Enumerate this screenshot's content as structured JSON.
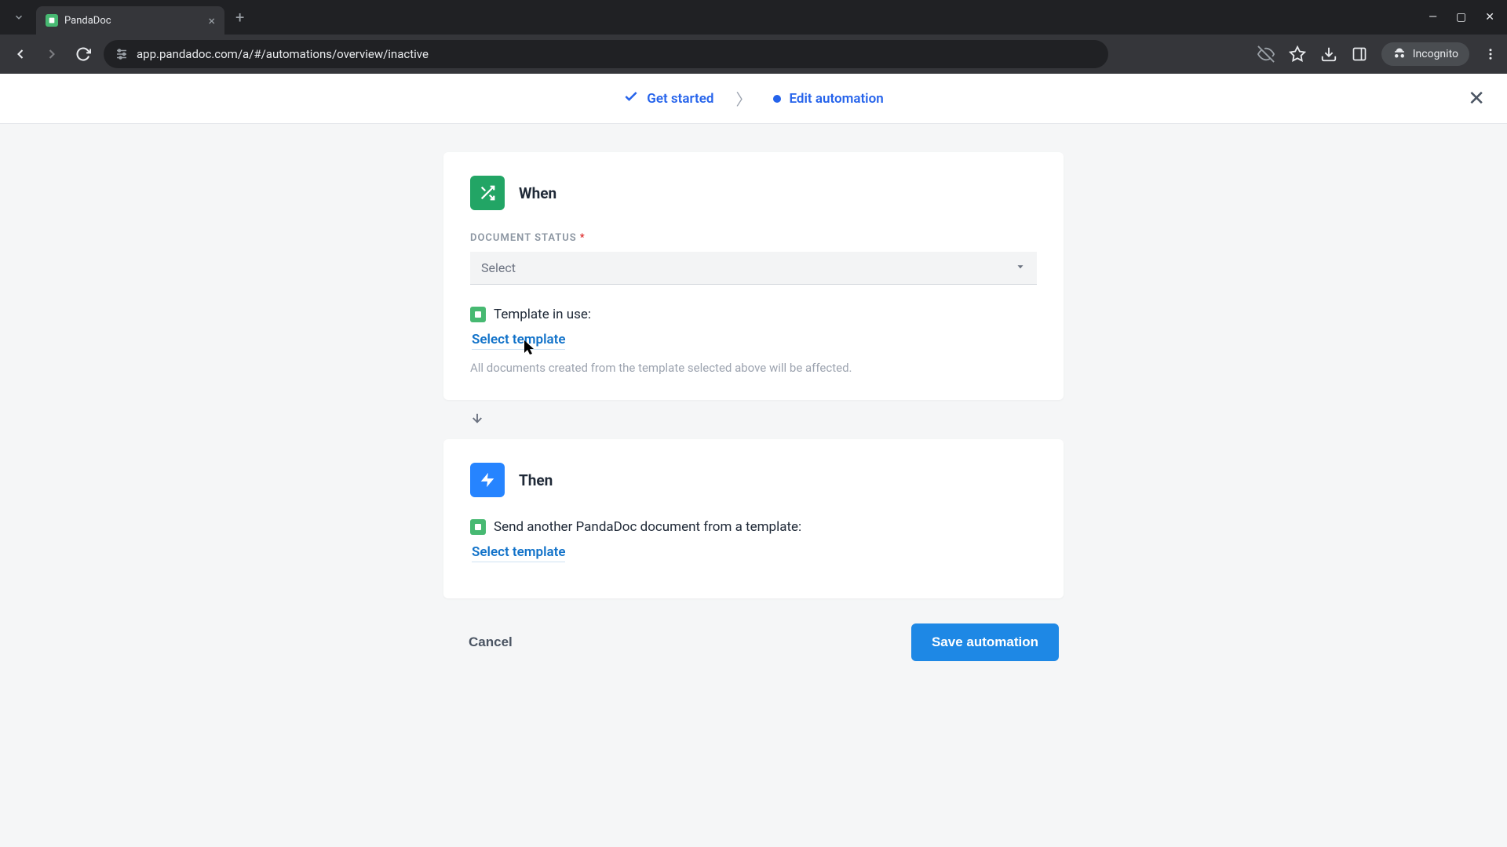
{
  "browser": {
    "tab_title": "PandaDoc",
    "url": "app.pandadoc.com/a/#/automations/overview/inactive",
    "incognito_label": "Incognito"
  },
  "header": {
    "step1": "Get started",
    "step2": "Edit automation"
  },
  "when_card": {
    "title": "When",
    "field_label": "DOCUMENT STATUS",
    "select_placeholder": "Select",
    "template_label": "Template in use:",
    "select_template": "Select template",
    "hint": "All documents created from the template selected above will be affected."
  },
  "then_card": {
    "title": "Then",
    "action_label": "Send another PandaDoc document from a template:",
    "select_template": "Select template"
  },
  "actions": {
    "cancel": "Cancel",
    "save": "Save automation"
  }
}
